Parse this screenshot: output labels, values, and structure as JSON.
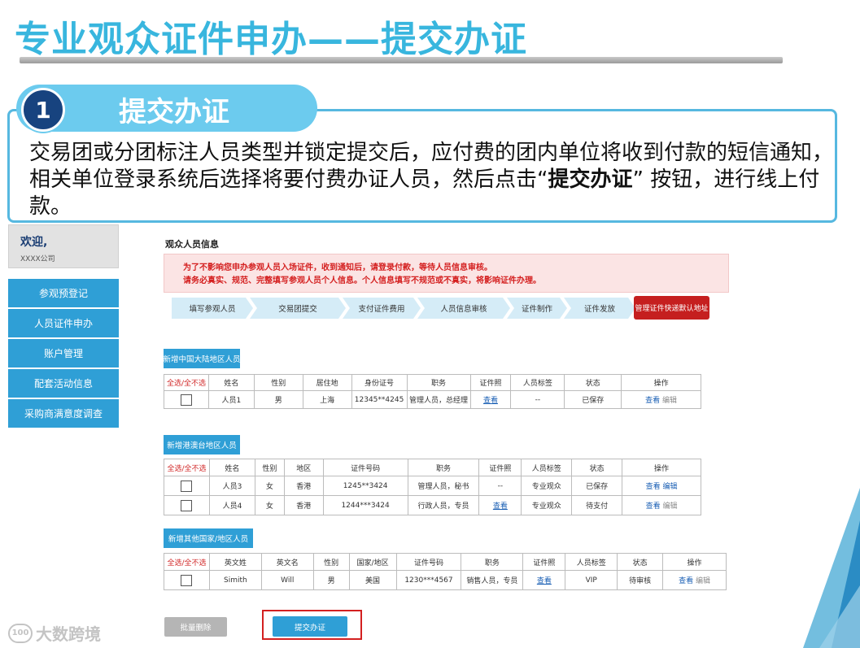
{
  "slide": {
    "title": "专业观众证件申办——提交办证",
    "step_number": "1",
    "step_title": "提交办证",
    "description_before": "交易团或分团标注人员类型并锁定提交后，应付费的团内单位将收到付款的短信通知，相关单位登录系统后选择将要付费办证人员，然后点击“",
    "description_bold": "提交办证",
    "description_after": "” 按钮，进行线上付款。"
  },
  "sidebar": {
    "welcome": "欢迎,",
    "company": "XXXX公司",
    "items": [
      {
        "label": "参观预登记"
      },
      {
        "label": "人员证件申办"
      },
      {
        "label": "账户管理"
      },
      {
        "label": "配套活动信息"
      },
      {
        "label": "采购商满意度调查"
      }
    ]
  },
  "main": {
    "section_title": "观众人员信息",
    "notice_line1": "为了不影响您申办参观人员入场证件，收到通知后，请登录付款，等待人员信息审核。",
    "notice_line2": "请务必真实、规范、完整填写参观人员个人信息。个人信息填写不规范或不真实，将影响证件办理。",
    "steps": [
      "填写参观人员",
      "交易团提交",
      "支付证件费用",
      "人员信息审核",
      "证件制作",
      "证件发放"
    ],
    "step_last": "管理证件快递默认地址"
  },
  "group1": {
    "label": "新增中国大陆地区人员",
    "headers": [
      "全选/全不选",
      "姓名",
      "性别",
      "居住地",
      "身份证号",
      "职务",
      "证件照",
      "人员标签",
      "状态",
      "操作"
    ],
    "rows": [
      {
        "name": "人员1",
        "gender": "男",
        "place": "上海",
        "id": "12345**4245",
        "position": "管理人员，总经理",
        "photo": "查看",
        "tag": "--",
        "status": "已保存",
        "view": "查看",
        "edit": "编辑"
      }
    ]
  },
  "group2": {
    "label": "新增港澳台地区人员",
    "headers": [
      "全选/全不选",
      "姓名",
      "性别",
      "地区",
      "证件号码",
      "职务",
      "证件照",
      "人员标签",
      "状态",
      "操作"
    ],
    "rows": [
      {
        "name": "人员3",
        "gender": "女",
        "place": "香港",
        "id": "1245**3424",
        "position": "管理人员，秘书",
        "photo": "--",
        "tag": "专业观众",
        "status": "已保存",
        "view": "查看",
        "edit": "编辑"
      },
      {
        "name": "人员4",
        "gender": "女",
        "place": "香港",
        "id": "1244***3424",
        "position": "行政人员，专员",
        "photo": "查看",
        "tag": "专业观众",
        "status": "待支付",
        "view": "查看",
        "edit": "编辑"
      }
    ]
  },
  "group3": {
    "label": "新增其他国家/地区人员",
    "headers": [
      "全选/全不选",
      "英文姓",
      "英文名",
      "性别",
      "国家/地区",
      "证件号码",
      "职务",
      "证件照",
      "人员标签",
      "状态",
      "操作"
    ],
    "rows": [
      {
        "last": "Simith",
        "first": "Will",
        "gender": "男",
        "country": "美国",
        "id": "1230***4567",
        "position": "销售人员，专员",
        "photo": "查看",
        "tag": "VIP",
        "status": "待审核",
        "view": "查看",
        "edit": "编辑"
      }
    ]
  },
  "buttons": {
    "batch_delete": "批量删除",
    "submit": "提交办证"
  },
  "watermark": {
    "icon_text": "100",
    "text": "大数跨境"
  },
  "colors": {
    "title_blue": "#38b6de",
    "menu_blue": "#2f9fd6",
    "alert_red": "#d41f1f",
    "step_active": "#c51f1f"
  }
}
